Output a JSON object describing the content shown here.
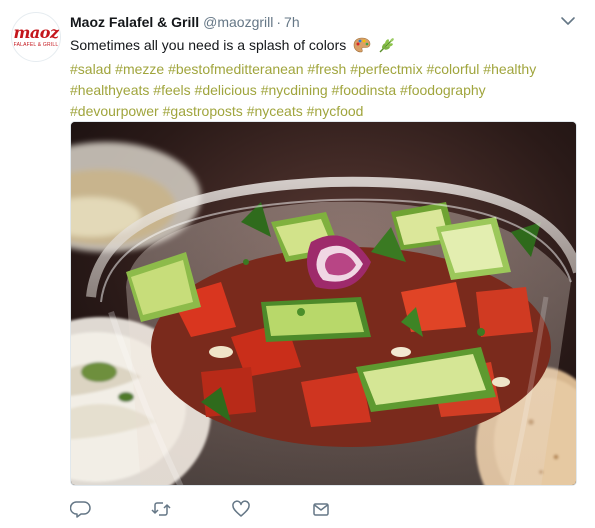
{
  "tweet": {
    "author": {
      "name": "Maoz Falafel & Grill",
      "handle": "@maozgrill",
      "avatar_logo": "maoz",
      "avatar_tagline": "FALAFEL & GRILL"
    },
    "separator": "·",
    "timestamp": "7h",
    "text": "Sometimes all you need is a splash of colors",
    "emojis": [
      "palette-icon",
      "herb-icon"
    ],
    "hashtags_line1": [
      "#salad",
      "#mezze",
      "#bestofmeditteranean",
      "#fresh",
      "#perfectmix",
      "#colorful",
      "#healthy"
    ],
    "hashtags_line2": [
      "#healthyeats",
      "#feels",
      "#delicious",
      "#nycdining",
      "#foodinsta",
      "#foodography"
    ],
    "hashtags_line3": [
      "#devourpower",
      "#gastroposts",
      "#nyceats",
      "#nycfood"
    ],
    "media": {
      "type": "photo",
      "subject": "salad-photo"
    },
    "actions": [
      "reply-icon",
      "retweet-icon",
      "like-icon",
      "message-icon"
    ],
    "colors": {
      "hashtag": "#a0a53d",
      "secondary_text": "#657786",
      "icon": "#657786",
      "brand": "#c4161c"
    }
  }
}
